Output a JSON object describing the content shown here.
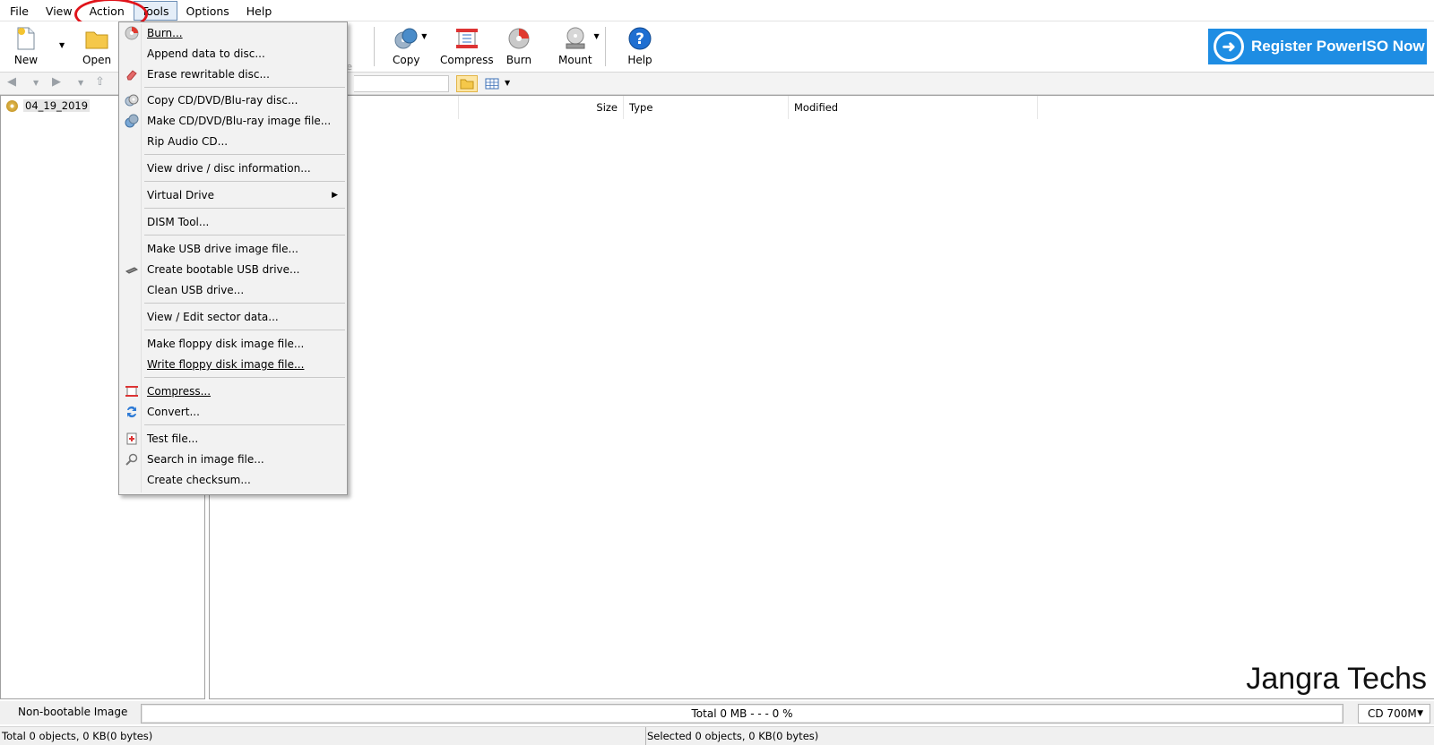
{
  "menubar": {
    "items": [
      "File",
      "View",
      "Action",
      "Tools",
      "Options",
      "Help"
    ],
    "active": "Tools"
  },
  "toolbar": {
    "new_label": "New",
    "open_label": "Open",
    "copy_label": "Copy",
    "compress_label": "Compress",
    "burn_label": "Burn",
    "mount_label": "Mount",
    "help_label": "Help",
    "register_label": "Register PowerISO Now",
    "hidden_fragment": "te"
  },
  "tree": {
    "root_label": "04_19_2019"
  },
  "columns": {
    "size": "Size",
    "type": "Type",
    "modified": "Modified"
  },
  "tools_menu": {
    "items": [
      {
        "label": "Burn...",
        "icon": "burn-disc-icon"
      },
      {
        "label": "Append data to disc...",
        "icon": ""
      },
      {
        "label": "Erase rewritable disc...",
        "icon": "eraser-icon"
      },
      {
        "label": "Copy CD/DVD/Blu-ray disc...",
        "icon": "copy-disc-icon"
      },
      {
        "label": "Make CD/DVD/Blu-ray image file...",
        "icon": "make-image-icon"
      },
      {
        "label": "Rip Audio CD...",
        "icon": ""
      },
      {
        "label": "View drive / disc information...",
        "icon": ""
      },
      {
        "label": "Virtual Drive",
        "icon": "",
        "submenu": true
      },
      {
        "label": "DISM Tool...",
        "icon": ""
      },
      {
        "label": "Make USB drive image file...",
        "icon": ""
      },
      {
        "label": "Create bootable USB drive...",
        "icon": "usb-icon"
      },
      {
        "label": "Clean USB drive...",
        "icon": ""
      },
      {
        "label": "View / Edit sector data...",
        "icon": ""
      },
      {
        "label": "Make floppy disk image file...",
        "icon": ""
      },
      {
        "label": "Write floppy disk image file...",
        "icon": ""
      },
      {
        "label": "Compress...",
        "icon": "compress-icon"
      },
      {
        "label": "Convert...",
        "icon": "convert-icon"
      },
      {
        "label": "Test file...",
        "icon": "test-file-icon"
      },
      {
        "label": "Search in image file...",
        "icon": "search-icon"
      },
      {
        "label": "Create checksum...",
        "icon": ""
      }
    ]
  },
  "status": {
    "boot_label": "Non-bootable Image",
    "progress_text": "Total  0 MB   - - -  0 %",
    "media_select": "CD 700M",
    "total_objects": "Total 0 objects, 0 KB(0 bytes)",
    "selected_objects": "Selected 0 objects, 0 KB(0 bytes)"
  },
  "watermark": "Jangra Techs",
  "colors": {
    "register_bg": "#1e8de3",
    "highlight_circle": "#e0141b"
  }
}
